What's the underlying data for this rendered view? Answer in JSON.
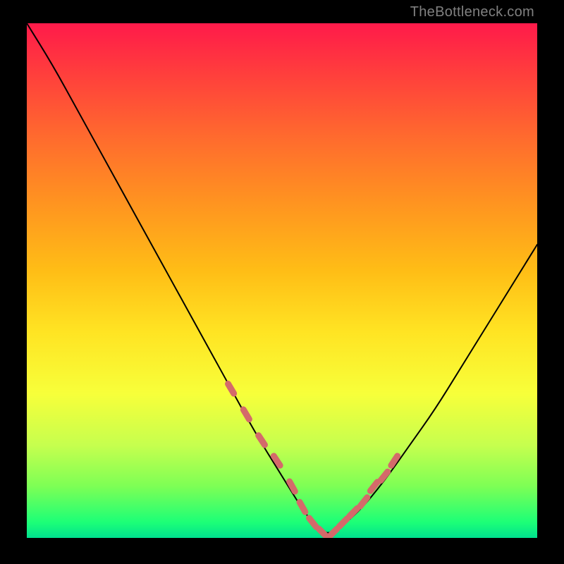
{
  "watermark": "TheBottleneck.com",
  "chart_data": {
    "type": "line",
    "title": "",
    "xlabel": "",
    "ylabel": "",
    "xlim": [
      0,
      100
    ],
    "ylim": [
      0,
      100
    ],
    "background_gradient": {
      "top": "#ff1a4a",
      "mid": "#ffe423",
      "bottom": "#00e08e"
    },
    "series": [
      {
        "name": "bottleneck-curve",
        "stroke": "#000000",
        "x": [
          0,
          5,
          10,
          15,
          20,
          25,
          30,
          35,
          40,
          45,
          50,
          55,
          58,
          60,
          65,
          70,
          75,
          80,
          85,
          90,
          95,
          100
        ],
        "y": [
          100,
          92,
          83,
          74,
          65,
          56,
          47,
          38,
          29,
          20,
          12,
          4,
          1,
          1,
          5,
          11,
          18,
          25,
          33,
          41,
          49,
          57
        ]
      },
      {
        "name": "highlight-dots-left",
        "stroke": "#d46a6a",
        "style": "dotted-thick",
        "x": [
          40,
          43,
          46,
          49,
          52,
          54,
          56,
          58
        ],
        "y": [
          29,
          24,
          19,
          15,
          10,
          6,
          3,
          1
        ]
      },
      {
        "name": "highlight-dots-right",
        "stroke": "#d46a6a",
        "style": "dotted-thick",
        "x": [
          60,
          62,
          64,
          66,
          68,
          70,
          72
        ],
        "y": [
          1,
          3,
          5,
          7,
          10,
          12,
          15
        ]
      }
    ]
  }
}
